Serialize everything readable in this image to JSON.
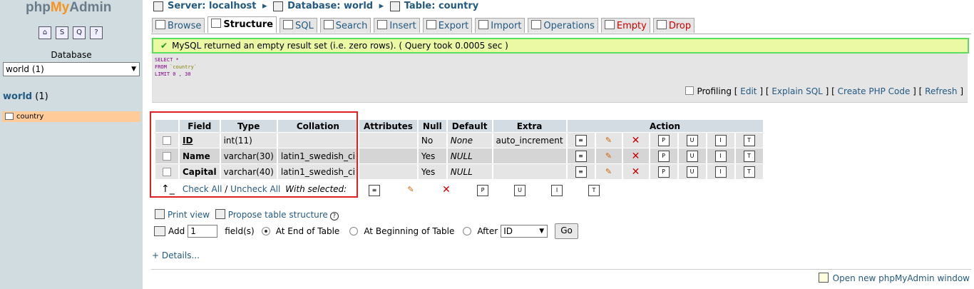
{
  "nav": {
    "logo": {
      "php": "php",
      "my": "My",
      "admin": "Admin"
    },
    "quick_icons": [
      "home-icon",
      "sql-icon",
      "query-window-icon",
      "docs-icon"
    ],
    "database_label": "Database",
    "database_select": "world (1)",
    "db_name": "world",
    "db_count": "(1)",
    "table_item": "country"
  },
  "breadcrumb": {
    "server": "Server: localhost",
    "database": "Database: world",
    "table": "Table: country"
  },
  "tabs": [
    "Browse",
    "Structure",
    "SQL",
    "Search",
    "Insert",
    "Export",
    "Import",
    "Operations",
    "Empty",
    "Drop"
  ],
  "notice": "MySQL returned an empty result set (i.e. zero rows). ( Query took 0.0005 sec )",
  "sql": {
    "line1": "SELECT *",
    "line2_kw": "FROM ",
    "line2_tbl": "`country`",
    "line3": "LIMIT 0 , 30",
    "links": {
      "profiling": "Profiling",
      "edit": "Edit",
      "explain": "Explain SQL",
      "php": "Create PHP Code",
      "refresh": "Refresh"
    }
  },
  "structure": {
    "headers": [
      "Field",
      "Type",
      "Collation",
      "Attributes",
      "Null",
      "Default",
      "Extra",
      "Action"
    ],
    "rows": [
      {
        "field": "ID",
        "type": "int(11)",
        "collation": "",
        "attributes": "",
        "null": "No",
        "default": "None",
        "extra": "auto_increment"
      },
      {
        "field": "Name",
        "type": "varchar(30)",
        "collation": "latin1_swedish_ci",
        "attributes": "",
        "null": "Yes",
        "default": "NULL",
        "extra": ""
      },
      {
        "field": "Capital",
        "type": "varchar(40)",
        "collation": "latin1_swedish_ci",
        "attributes": "",
        "null": "Yes",
        "default": "NULL",
        "extra": ""
      }
    ],
    "check_all": "Check All",
    "sep": "/",
    "uncheck_all": "Uncheck All",
    "with_selected": "With selected:"
  },
  "bottom": {
    "print_view": "Print view",
    "propose": "Propose table structure",
    "add_label": "Add",
    "add_value": "1",
    "fields_label": "field(s)",
    "at_end": "At End of Table",
    "at_begin": "At Beginning of Table",
    "after": "After",
    "after_select": "ID",
    "go": "Go",
    "details": "+ Details...",
    "open_window": "Open new phpMyAdmin window"
  }
}
